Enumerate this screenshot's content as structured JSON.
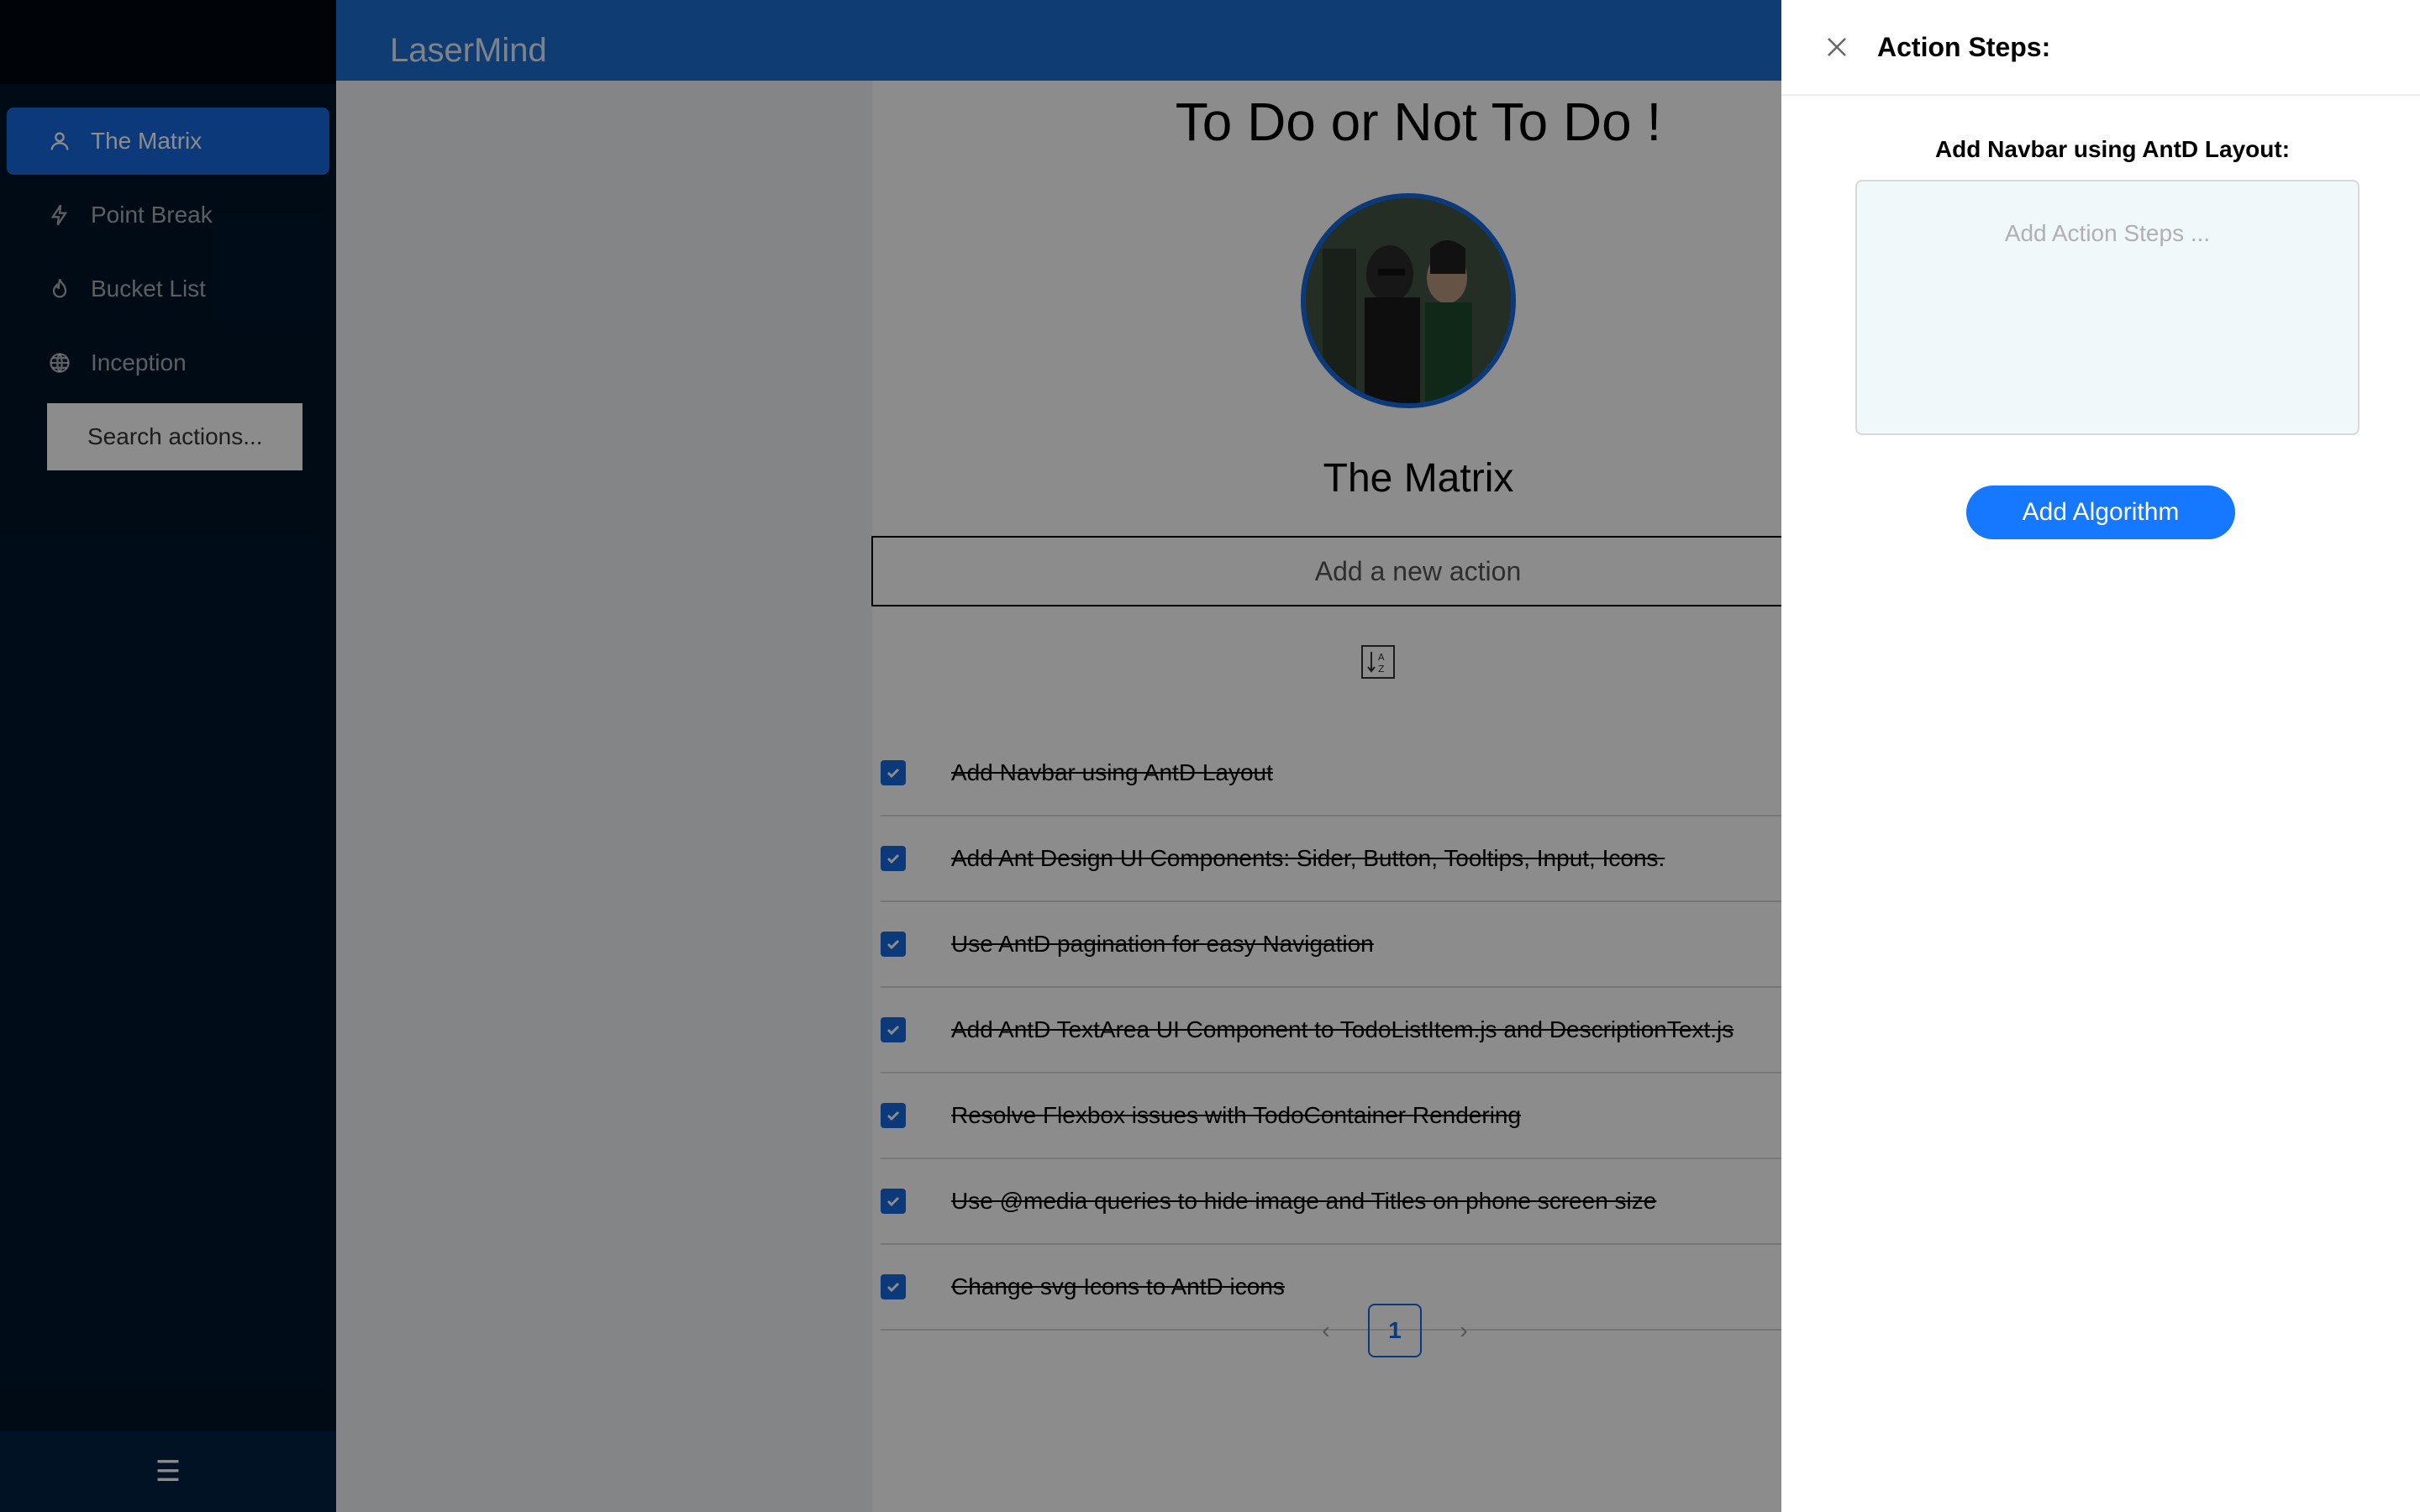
{
  "app": {
    "logo": "LaserMind"
  },
  "sidebar": {
    "items": [
      {
        "label": "The Matrix",
        "icon": "user-icon",
        "active": true
      },
      {
        "label": "Point Break",
        "icon": "lightning-icon",
        "active": false
      },
      {
        "label": "Bucket List",
        "icon": "fire-icon",
        "active": false
      },
      {
        "label": "Inception",
        "icon": "globe-icon",
        "active": false
      }
    ],
    "search_placeholder": "Search actions...",
    "trigger_icon": "menu-icon"
  },
  "main": {
    "title": "To Do or Not To Do !",
    "list_title": "The Matrix",
    "new_action_placeholder": "Add a new action",
    "sort_icon": "sort-alpha-icon",
    "todos": [
      {
        "text": "Add Navbar using AntD Layout",
        "done": true
      },
      {
        "text": "Add Ant Design UI Components: Sider, Button, Tooltips, Input, Icons.",
        "done": true
      },
      {
        "text": "Use AntD pagination for easy Navigation",
        "done": true
      },
      {
        "text": "Add AntD TextArea UI Component to TodoListItem.js and DescriptionText.js",
        "done": true
      },
      {
        "text": "Resolve Flexbox issues with TodoContainer Rendering",
        "done": true
      },
      {
        "text": "Use @media queries to hide image and Titles on phone screen size",
        "done": true
      },
      {
        "text": "Change svg Icons to AntD icons",
        "done": true
      }
    ],
    "pagination": {
      "current": "1",
      "prev_icon": "chevron-left-icon",
      "next_icon": "chevron-right-icon"
    }
  },
  "drawer": {
    "title": "Action Steps:",
    "subtitle": "Add Navbar using AntD Layout:",
    "steps_placeholder": "Add Action Steps ...",
    "button_label": "Add Algorithm",
    "close_icon": "close-icon"
  },
  "colors": {
    "primary": "#1677ff",
    "sider": "#001529",
    "header": "#1d6fd1"
  }
}
